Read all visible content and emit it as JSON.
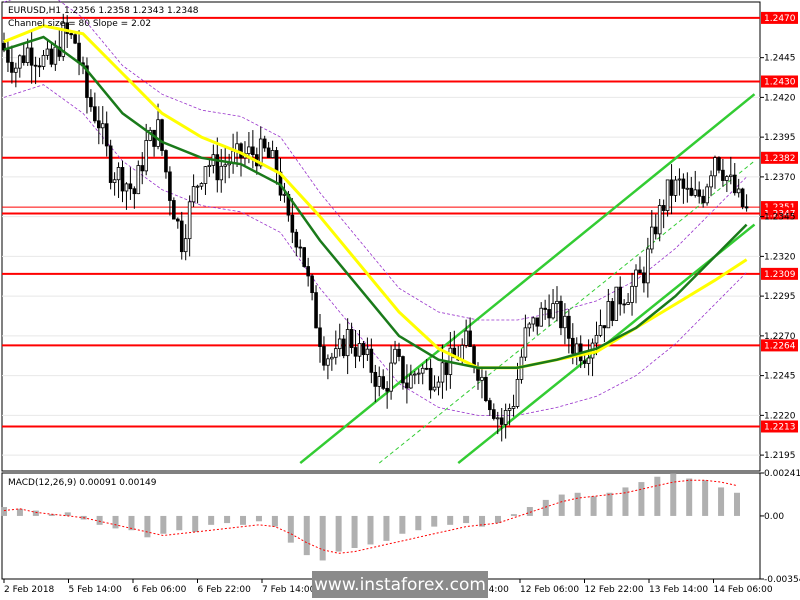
{
  "header": {
    "symbol_line": "EURUSD,H1  1.2356 1.2358 1.2343 1.2348",
    "channel_line": "Channel size = 80 Slope = 2.02"
  },
  "watermark": {
    "text": "www.instaforex.com"
  },
  "colors": {
    "level": "#ff0000",
    "current": "#ff0000",
    "ma_fast": "#1a7a1a",
    "ma_slow": "#ffff00",
    "channel": "#33cc33",
    "envelope": "#9933cc",
    "macd_hist": "#b0b0b0",
    "macd_signal": "#ff0000"
  },
  "chart_data": [
    {
      "type": "candlestick",
      "title": "EURUSD,H1",
      "ylim": [
        1.2185,
        1.248
      ],
      "y_ticks": [
        "1.2445",
        "1.2420",
        "1.2395",
        "1.2370",
        "1.2345",
        "1.2320",
        "1.2295",
        "1.2270",
        "1.2245",
        "1.2220",
        "1.2195"
      ],
      "x_labels": [
        "2 Feb 2018",
        "5 Feb 14:00",
        "6 Feb 06:00",
        "6 Feb 22:00",
        "7 Feb 14:00",
        "8 Feb 06:00",
        "8 Feb 22:00",
        "9 Feb 14:00",
        "12 Feb 06:00",
        "12 Feb 22:00",
        "13 Feb 14:00",
        "14 Feb 06:00"
      ],
      "levels": [
        "1.2470",
        "1.2430",
        "1.2382",
        "1.2347",
        "1.2309",
        "1.2264",
        "1.2213"
      ],
      "current_price": "1.2351",
      "close_path": [
        [
          0,
          1.245
        ],
        [
          3,
          1.244
        ],
        [
          6,
          1.245
        ],
        [
          9,
          1.2445
        ],
        [
          12,
          1.244
        ],
        [
          15,
          1.246
        ],
        [
          18,
          1.2455
        ],
        [
          21,
          1.242
        ],
        [
          24,
          1.2405
        ],
        [
          27,
          1.2375
        ],
        [
          30,
          1.237
        ],
        [
          33,
          1.236
        ],
        [
          36,
          1.239
        ],
        [
          39,
          1.24
        ],
        [
          42,
          1.236
        ],
        [
          45,
          1.233
        ],
        [
          48,
          1.236
        ],
        [
          51,
          1.238
        ],
        [
          54,
          1.2375
        ],
        [
          57,
          1.238
        ],
        [
          60,
          1.2383
        ],
        [
          63,
          1.2385
        ],
        [
          66,
          1.2385
        ],
        [
          69,
          1.2375
        ],
        [
          72,
          1.234
        ],
        [
          75,
          1.233
        ],
        [
          78,
          1.229
        ],
        [
          81,
          1.226
        ],
        [
          84,
          1.2255
        ],
        [
          87,
          1.227
        ],
        [
          90,
          1.226
        ],
        [
          93,
          1.225
        ],
        [
          96,
          1.2235
        ],
        [
          99,
          1.2255
        ],
        [
          102,
          1.224
        ],
        [
          105,
          1.225
        ],
        [
          108,
          1.2245
        ],
        [
          111,
          1.225
        ],
        [
          114,
          1.2255
        ],
        [
          117,
          1.2265
        ],
        [
          120,
          1.225
        ],
        [
          123,
          1.223
        ],
        [
          126,
          1.2215
        ],
        [
          129,
          1.223
        ],
        [
          132,
          1.227
        ],
        [
          135,
          1.228
        ],
        [
          138,
          1.229
        ],
        [
          141,
          1.228
        ],
        [
          144,
          1.2265
        ],
        [
          147,
          1.226
        ],
        [
          150,
          1.2275
        ],
        [
          153,
          1.2285
        ],
        [
          156,
          1.2295
        ],
        [
          159,
          1.23
        ],
        [
          162,
          1.231
        ],
        [
          165,
          1.234
        ],
        [
          168,
          1.236
        ],
        [
          171,
          1.2365
        ],
        [
          174,
          1.2355
        ],
        [
          177,
          1.236
        ],
        [
          180,
          1.2385
        ],
        [
          183,
          1.237
        ],
        [
          186,
          1.2355
        ],
        [
          188,
          1.2348
        ]
      ],
      "series": [
        {
          "values": [
            [
              0,
              1.245
            ],
            [
              10,
              1.2458
            ],
            [
              20,
              1.244
            ],
            [
              30,
              1.241
            ],
            [
              40,
              1.2392
            ],
            [
              50,
              1.2382
            ],
            [
              60,
              1.2378
            ],
            [
              70,
              1.2365
            ],
            [
              80,
              1.233
            ],
            [
              90,
              1.23
            ],
            [
              100,
              1.227
            ],
            [
              110,
              1.2255
            ],
            [
              120,
              1.225
            ],
            [
              130,
              1.225
            ],
            [
              140,
              1.2255
            ],
            [
              150,
              1.2262
            ],
            [
              160,
              1.2275
            ],
            [
              170,
              1.2295
            ],
            [
              180,
              1.232
            ],
            [
              188,
              1.234
            ]
          ]
        },
        {
          "values": [
            [
              0,
              1.2455
            ],
            [
              10,
              1.2465
            ],
            [
              20,
              1.246
            ],
            [
              30,
              1.2435
            ],
            [
              40,
              1.241
            ],
            [
              50,
              1.2395
            ],
            [
              60,
              1.2385
            ],
            [
              70,
              1.2372
            ],
            [
              80,
              1.2345
            ],
            [
              90,
              1.2315
            ],
            [
              100,
              1.2285
            ],
            [
              110,
              1.2262
            ],
            [
              120,
              1.225
            ],
            [
              130,
              1.225
            ],
            [
              140,
              1.2255
            ],
            [
              150,
              1.226
            ],
            [
              160,
              1.2275
            ],
            [
              170,
              1.229
            ],
            [
              180,
              1.2305
            ],
            [
              188,
              1.2318
            ]
          ]
        }
      ]
    },
    {
      "type": "bar",
      "title": "MACD(12,26,9) 0.00091 0.00149",
      "ylim": [
        -0.00354,
        0.00241
      ],
      "y_ticks": [
        "0.00241",
        "0.00",
        "-0.00354"
      ],
      "values": [
        0.0005,
        0.0004,
        0.0003,
        0.0001,
        0.0002,
        -0.0002,
        -0.0005,
        -0.0007,
        -0.0008,
        -0.0012,
        -0.001,
        -0.0008,
        -0.0009,
        -0.0005,
        -0.0004,
        -0.0005,
        -0.0003,
        -0.0006,
        -0.0015,
        -0.0022,
        -0.0025,
        -0.002,
        -0.0018,
        -0.0016,
        -0.0014,
        -0.001,
        -0.0008,
        -0.0006,
        -0.0005,
        -0.0004,
        -0.0006,
        -0.0004,
        0.0001,
        0.0005,
        0.0009,
        0.0012,
        0.0013,
        0.0011,
        0.0013,
        0.0016,
        0.0019,
        0.0022,
        0.0024,
        0.0021,
        0.002,
        0.0016,
        0.0013
      ],
      "series": [
        {
          "values": [
            0.0003,
            0.0004,
            0.0002,
            0.0001,
            0.0,
            -0.0001,
            -0.0003,
            -0.0005,
            -0.0007,
            -0.0009,
            -0.0011,
            -0.001,
            -0.0009,
            -0.0008,
            -0.0007,
            -0.0006,
            -0.0005,
            -0.0006,
            -0.001,
            -0.0015,
            -0.0019,
            -0.0021,
            -0.002,
            -0.0018,
            -0.0016,
            -0.0014,
            -0.0012,
            -0.001,
            -0.0008,
            -0.0006,
            -0.0005,
            -0.0004,
            -0.0001,
            0.0002,
            0.0005,
            0.0008,
            0.001,
            0.0011,
            0.0012,
            0.0013,
            0.0015,
            0.0017,
            0.0019,
            0.002,
            0.002,
            0.0019,
            0.0017
          ]
        }
      ]
    }
  ]
}
